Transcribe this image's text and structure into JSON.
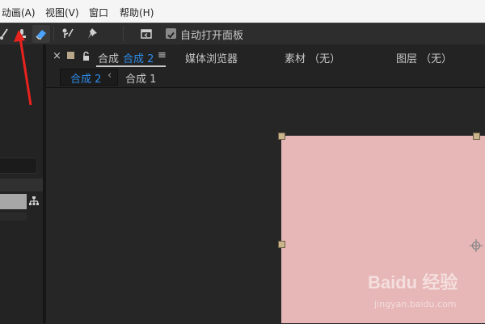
{
  "menubar": {
    "items": [
      "动画(A)",
      "视图(V)",
      "窗口",
      "帮助(H)"
    ]
  },
  "toolbar": {
    "auto_open_panel_label": "自动打开面板",
    "auto_open_checked": true
  },
  "panel_tabs": {
    "close": "×",
    "comp_prefix": "合成",
    "comp_name": "合成 2",
    "menu_glyph": "≡",
    "media_browser": "媒体浏览器",
    "footage": "素材 （无）",
    "layer": "图层 （无）"
  },
  "breadcrumb": {
    "active": "合成 2",
    "separator": "‹",
    "parent": "合成 1"
  },
  "colors": {
    "accent": "#2d8ceb",
    "comp_fill": "#e7b6b6",
    "annotation_arrow": "#e8231e"
  },
  "watermark": {
    "brand": "Baidu 经验",
    "url": "jingyan.baidu.com"
  }
}
